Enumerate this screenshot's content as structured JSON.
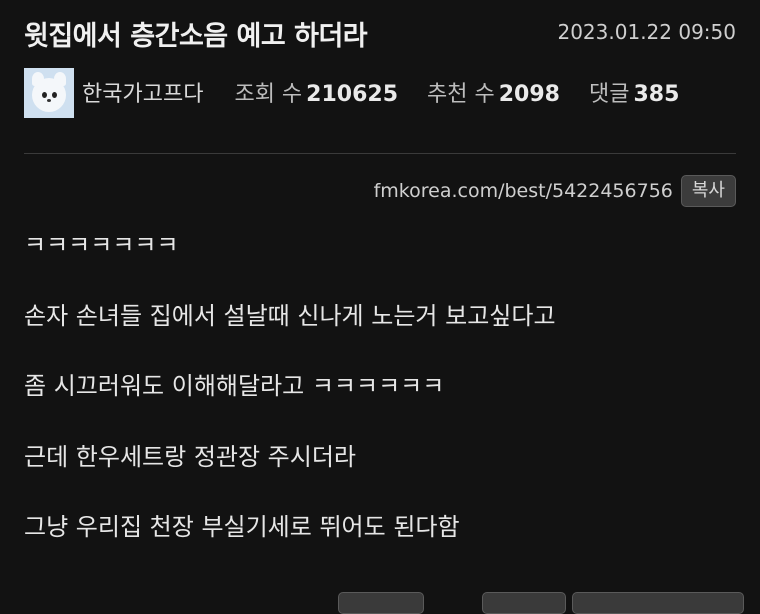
{
  "post": {
    "title": "윗집에서 층간소음 예고 하더라",
    "date": "2023.01.22 09:50"
  },
  "author": {
    "nickname": "한국가고프다",
    "avatar_icon": "samoyed-dog-avatar"
  },
  "stats": {
    "views_label": "조회 수",
    "views_value": "210625",
    "recommend_label": "추천 수",
    "recommend_value": "2098",
    "comments_label": "댓글",
    "comments_value": "385"
  },
  "link": {
    "url": "fmkorea.com/best/5422456756",
    "copy_label": "복사"
  },
  "content": {
    "lines": [
      "ㅋㅋㅋㅋㅋㅋㅋ",
      "손자 손녀들 집에서 설날때 신나게 노는거 보고싶다고",
      "좀 시끄러워도 이해해달라고 ㅋㅋㅋㅋㅋㅋ",
      "근데 한우세트랑 정관장 주시더라",
      "그냥 우리집 천장 부실기세로 뛰어도 된다함"
    ]
  },
  "colors": {
    "background": "#121212",
    "text": "#e8e8e8",
    "button": "#3c3c3c"
  }
}
